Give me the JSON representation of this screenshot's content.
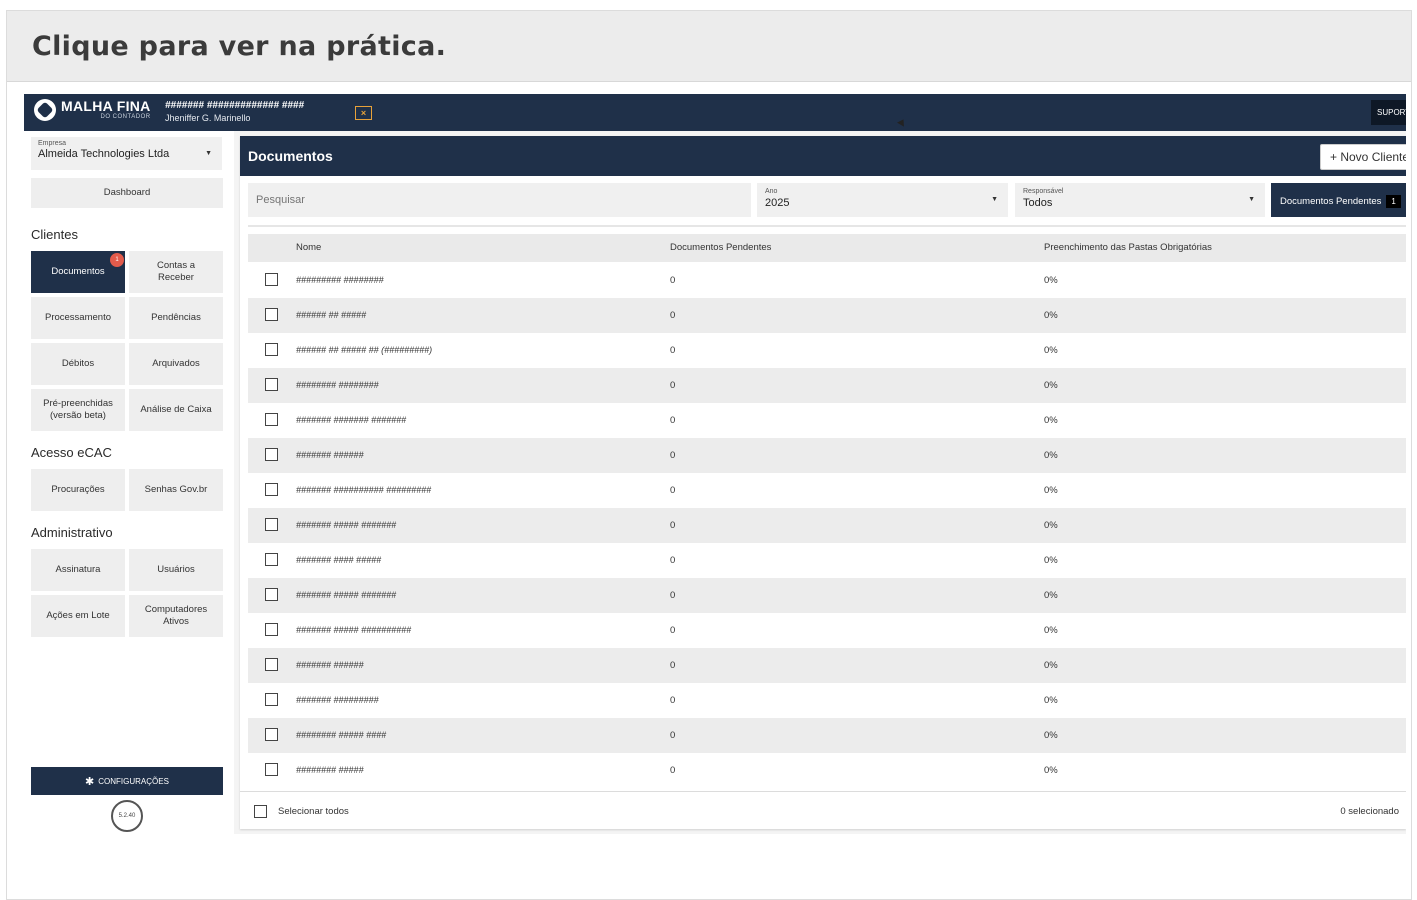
{
  "banner": {
    "title": "Clique para ver na prática."
  },
  "topbar": {
    "logo_main": "MALHA FINA",
    "logo_sub": "DO CONTADOR",
    "masked_line": "####### ############# ####",
    "user_name": "Jheniffer G. Marinello",
    "close_icon": "×",
    "support_label": "SUPORTE"
  },
  "sidebar": {
    "empresa_label": "Empresa",
    "empresa_value": "Almeida Technologies Ltda",
    "dashboard": "Dashboard",
    "section_clientes": "Clientes",
    "documentos": "Documentos",
    "documentos_badge": "1",
    "contas_receber": "Contas a Receber",
    "processamento": "Processamento",
    "pendencias": "Pendências",
    "debitos": "Débitos",
    "arquivados": "Arquivados",
    "pre_preenchidas": "Pré-preenchidas (versão beta)",
    "analise_caixa": "Análise de Caixa",
    "section_ecac": "Acesso eCAC",
    "procuracoes": "Procurações",
    "senhas_gov": "Senhas Gov.br",
    "section_admin": "Administrativo",
    "assinatura": "Assinatura",
    "usuarios": "Usuários",
    "acoes_lote": "Ações em Lote",
    "computadores": "Computadores Ativos",
    "config_label": "CONFIGURAÇÕES",
    "version": "5.2.40"
  },
  "main": {
    "title": "Documentos",
    "novo_cliente": "+ Novo Cliente",
    "search_placeholder": "Pesquisar",
    "ano_label": "Ano",
    "ano_value": "2025",
    "resp_label": "Responsável",
    "resp_value": "Todos",
    "docs_pendentes_label": "Documentos Pendentes",
    "docs_pendentes_count": "1"
  },
  "table": {
    "columns": [
      "Nome",
      "Documentos Pendentes",
      "Preenchimento das Pastas Obrigatórias"
    ],
    "rows": [
      {
        "name": "######### ########",
        "pend": "0",
        "fill": "0%"
      },
      {
        "name": "###### ## #####",
        "pend": "0",
        "fill": "0%"
      },
      {
        "name": "###### ## ##### ## (#########)",
        "pend": "0",
        "fill": "0%"
      },
      {
        "name": "######## ########",
        "pend": "0",
        "fill": "0%"
      },
      {
        "name": "####### ####### #######",
        "pend": "0",
        "fill": "0%"
      },
      {
        "name": "####### ######",
        "pend": "0",
        "fill": "0%"
      },
      {
        "name": "####### ########## #########",
        "pend": "0",
        "fill": "0%"
      },
      {
        "name": "####### ##### #######",
        "pend": "0",
        "fill": "0%"
      },
      {
        "name": "####### #### #####",
        "pend": "0",
        "fill": "0%"
      },
      {
        "name": "####### ##### #######",
        "pend": "0",
        "fill": "0%"
      },
      {
        "name": "####### ##### ##########",
        "pend": "0",
        "fill": "0%"
      },
      {
        "name": "####### ######",
        "pend": "0",
        "fill": "0%"
      },
      {
        "name": "####### #########",
        "pend": "0",
        "fill": "0%"
      },
      {
        "name": "######## ##### ####",
        "pend": "0",
        "fill": "0%"
      },
      {
        "name": "######## #####",
        "pend": "0",
        "fill": "0%"
      }
    ]
  },
  "footer": {
    "select_all": "Selecionar todos",
    "selected_count": "0 selecionado"
  }
}
